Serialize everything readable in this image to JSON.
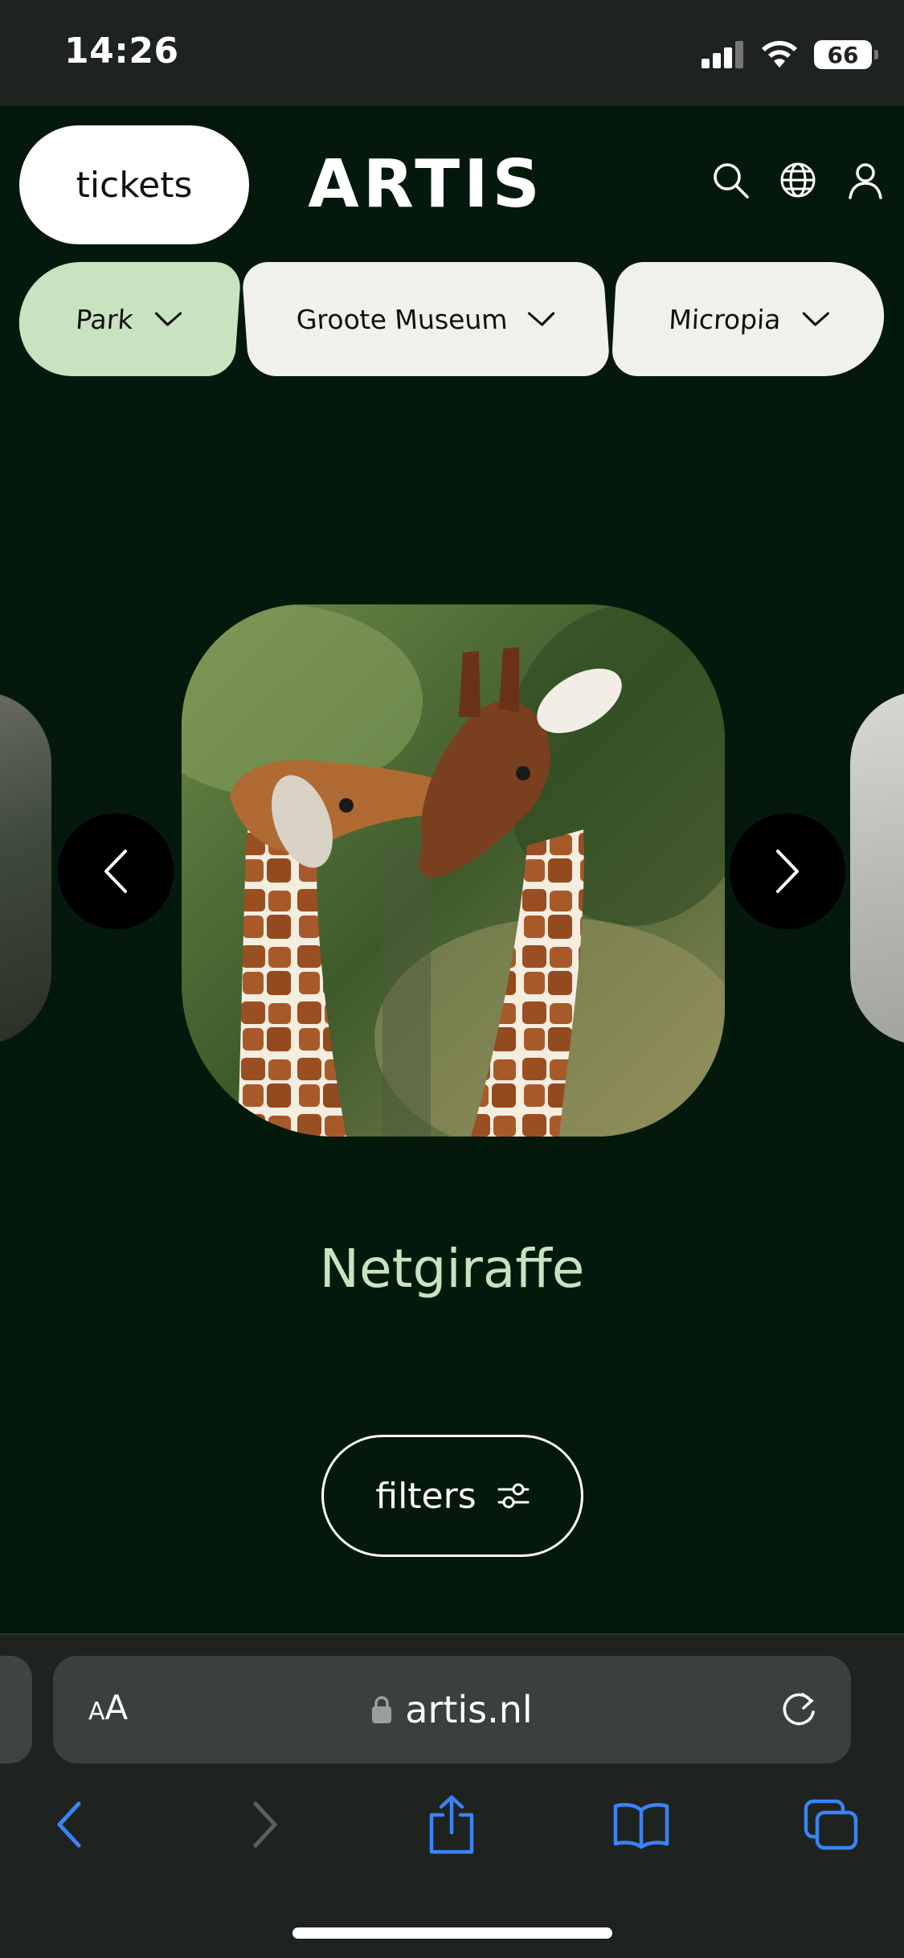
{
  "status_bar": {
    "time": "14:26",
    "battery": "66"
  },
  "header": {
    "tickets_label": "tickets",
    "brand": "ARTIS",
    "icons": [
      "search-icon",
      "globe-icon",
      "account-icon"
    ]
  },
  "locations": [
    {
      "label": "Park",
      "selected": true,
      "color": "#c9e3c1"
    },
    {
      "label": "Groote Museum",
      "selected": false,
      "color": "#f0f0ec"
    },
    {
      "label": "Micropia",
      "selected": false,
      "color": "#f0f0ec"
    }
  ],
  "carousel": {
    "current_animal": "Netgiraffe",
    "prev_icon": "chevron-left-icon",
    "next_icon": "chevron-right-icon"
  },
  "filters": {
    "label": "filters",
    "icon": "sliders-icon"
  },
  "browser": {
    "aa_small": "A",
    "aa_large": "A",
    "url": "artis.nl",
    "toolbar": [
      "back-icon",
      "forward-icon",
      "share-icon",
      "bookmarks-icon",
      "tabs-icon"
    ]
  },
  "colors": {
    "background": "#04190c",
    "accent": "#c9e3c1",
    "chrome": "#1e231f",
    "link_blue": "#3b82f6"
  }
}
